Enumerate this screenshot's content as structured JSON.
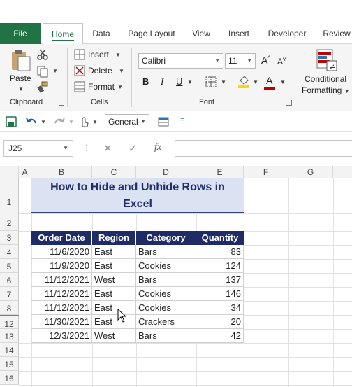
{
  "tabs": [
    "File",
    "Home",
    "Data",
    "Page Layout",
    "View",
    "Insert",
    "Developer",
    "Review"
  ],
  "ribbon": {
    "clipboard": {
      "paste": "Paste",
      "label": "Clipboard"
    },
    "cells": {
      "insert": "Insert",
      "delete": "Delete",
      "format": "Format",
      "label": "Cells"
    },
    "font": {
      "family": "Calibri",
      "size": "11",
      "bold": "B",
      "italic": "I",
      "underline": "U",
      "grow": "A",
      "shrink": "A",
      "color_letter": "A",
      "label": "Font"
    },
    "styles": {
      "conditional_line1": "Conditional",
      "conditional_line2": "Formatting"
    }
  },
  "qat": {
    "number_format": "General"
  },
  "formula_bar": {
    "name_box": "J25",
    "fx": "fx",
    "value": ""
  },
  "sheet": {
    "columns": [
      "A",
      "B",
      "C",
      "D",
      "E",
      "F",
      "G"
    ],
    "rows": [
      "1",
      "2",
      "3",
      "4",
      "5",
      "6",
      "7",
      "8",
      "12",
      "13",
      "14",
      "15",
      "16"
    ],
    "title_line1": "How to Hide and Unhide Rows in",
    "title_line2": "Excel",
    "headers": [
      "Order Date",
      "Region",
      "Category",
      "Quantity"
    ],
    "data": [
      [
        "11/6/2020",
        "East",
        "Bars",
        "83"
      ],
      [
        "11/9/2020",
        "East",
        "Cookies",
        "124"
      ],
      [
        "11/12/2021",
        "West",
        "Bars",
        "137"
      ],
      [
        "11/12/2021",
        "East",
        "Cookies",
        "146"
      ],
      [
        "11/12/2021",
        "East",
        "Cookies",
        "34"
      ],
      [
        "11/30/2021",
        "East",
        "Crackers",
        "20"
      ],
      [
        "12/3/2021",
        "West",
        "Bars",
        "42"
      ]
    ]
  },
  "colors": {
    "file_tab": "#217346",
    "header_fill": "#1f2b66",
    "title_fill": "#dbe3f3",
    "title_text": "#1f2d6b",
    "highlight": "#ffd800",
    "font_color": "#c00000"
  }
}
